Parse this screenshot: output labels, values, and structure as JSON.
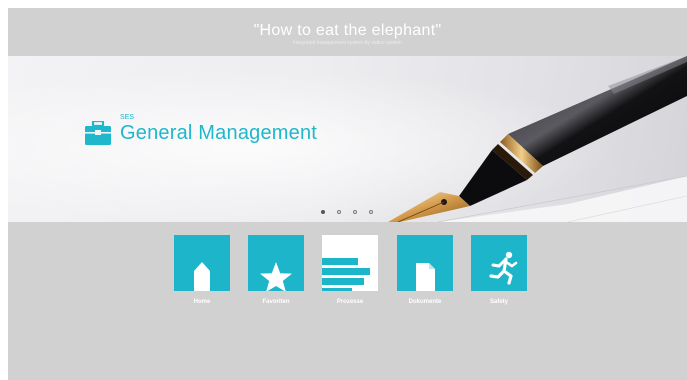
{
  "header": {
    "title": "\"How to eat the elephant\"",
    "subtitle": "integrated management system by status system"
  },
  "banner": {
    "brand_prefix": "SES",
    "brand_name": "General Management",
    "icon": "briefcase-icon",
    "carousel": {
      "slides": 4,
      "active_index": 0
    }
  },
  "tiles": [
    {
      "label": "Home",
      "icon": "home-icon"
    },
    {
      "label": "Favoriten",
      "icon": "star-icon"
    },
    {
      "label": "Prozesse",
      "icon": "process-bars-icon"
    },
    {
      "label": "Dokumente",
      "icon": "document-icon"
    },
    {
      "label": "Safety",
      "icon": "running-person-icon"
    }
  ],
  "colors": {
    "accent": "#1cb5c9",
    "background": "#d1d1d1",
    "label_text": "#ffffff"
  }
}
